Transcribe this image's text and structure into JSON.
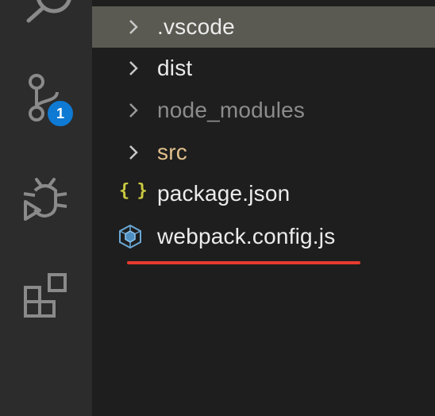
{
  "activity_bar": {
    "icons": [
      "search-icon",
      "source-control-icon",
      "debug-icon",
      "extensions-icon"
    ],
    "source_control_badge": "1",
    "badge_color": "#0e7ad4"
  },
  "explorer": {
    "items": [
      {
        "label": ".vscode",
        "type": "folder",
        "color": "#e8e8e8",
        "selected": true
      },
      {
        "label": "dist",
        "type": "folder",
        "color": "#e8e8e8"
      },
      {
        "label": "node_modules",
        "type": "folder",
        "color": "#8c8c8c"
      },
      {
        "label": "src",
        "type": "folder",
        "color": "#e2c08d"
      },
      {
        "label": "package.json",
        "type": "file",
        "icon": "json-braces-icon",
        "icon_glyph": "{ }",
        "color": "#e8e8e8"
      },
      {
        "label": "webpack.config.js",
        "type": "file",
        "icon": "webpack-cube-icon",
        "color": "#e8e8e8"
      }
    ],
    "annotation_underline_color": "#e83a2f"
  }
}
